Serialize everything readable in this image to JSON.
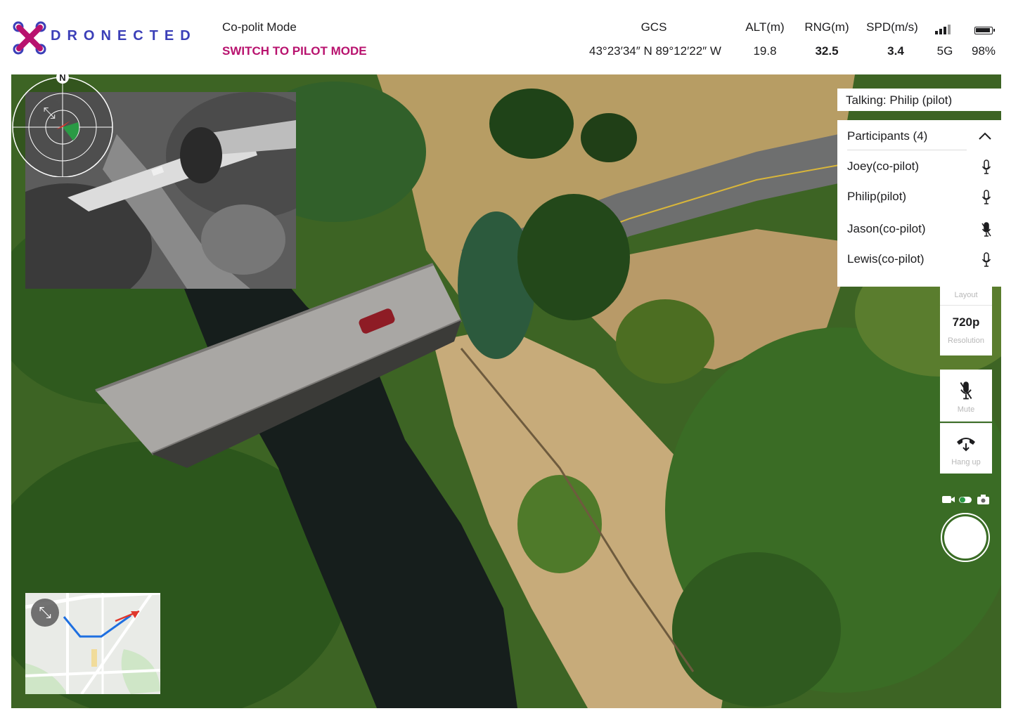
{
  "brand": {
    "name": "DRONECTED",
    "logo_colors": [
      "#b8126e",
      "#3b3fb8"
    ]
  },
  "header": {
    "mode_label": "Co-polit Mode",
    "switch_label": "SWITCH TO PILOT MODE",
    "stats": [
      {
        "label": "GCS",
        "value": "43°23′34″ N 89°12′22″ W"
      },
      {
        "label": "ALT(m)",
        "value": "19.8"
      },
      {
        "label": "RNG(m)",
        "value": "32.5"
      },
      {
        "label": "SPD(m/s)",
        "value": "3.4"
      }
    ],
    "signal": {
      "icon": "signal-bars-icon",
      "value": "5G"
    },
    "battery": {
      "icon": "battery-icon",
      "value": "98%"
    }
  },
  "talking": "Talking: Philip (pilot)",
  "participants": {
    "title": "Participants (4)",
    "items": [
      {
        "name": "Joey(co-pilot)",
        "muted": false
      },
      {
        "name": "Philip(pilot)",
        "muted": false
      },
      {
        "name": "Jason(co-pilot)",
        "muted": true
      },
      {
        "name": "Lewis(co-pilot)",
        "muted": false
      }
    ]
  },
  "controls": {
    "layout_label": "Layout",
    "resolution_value": "720p",
    "resolution_label": "Resolution",
    "mute_label": "Mute",
    "hangup_label": "Hang up"
  },
  "compass": {
    "north_label": "N"
  },
  "colors": {
    "accent": "#b8126e",
    "route": "#1e6fe0",
    "heading_arrow": "#e0372c",
    "sector": "#2a9a45"
  }
}
